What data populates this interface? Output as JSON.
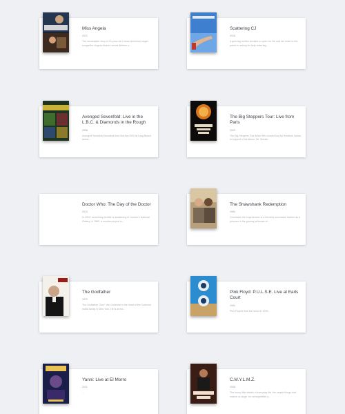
{
  "movies": [
    {
      "title": "Miss Angela",
      "year": "2021",
      "overview": "The remarkable story of 91-year-old Cuban-American singer-songwriter Angela Alvarez whose lifetime o..."
    },
    {
      "title": "Scattering CJ",
      "year": "2016",
      "overview": "A grieving mother decides to open her life and her heart to the public in asking for help restoring..."
    },
    {
      "title": "Avenged Sevenfold: Live in the L.B.C. & Diamonds in the Rough",
      "year": "2008",
      "overview": "Avenged Sevenfold recorded their first live DVD at Long Beach arena..."
    },
    {
      "title": "The Big Steppers Tour: Live from Paris",
      "year": "2022",
      "overview": "The Big Steppers Tour is the fifth concert tour by Kendrick Lamar, in support of his album, Mr. Morale..."
    },
    {
      "title": "Doctor Who: The Day of the Doctor",
      "year": "2013",
      "overview": "In 2013, something terrible is awakening in London's National Gallery; in 1562, a murderous plot is..."
    },
    {
      "title": "The Shawshank Redemption",
      "year": "1994",
      "overview": "Chronicles the experiences of a formerly successful banker as a prisoner in the gloomy jailhouse of..."
    },
    {
      "title": "The Godfather",
      "year": "1972",
      "overview": "The Godfather \"Don\" Vito Corleone is the head of the Corleone mafia family in New York. He is at the..."
    },
    {
      "title": "Pink Floyd: P.U.L.S.E. Live at Earls Court",
      "year": "1994",
      "overview": "Pink Floyd's final live show in 1995..."
    },
    {
      "title": "Yanni: Live at El Morro",
      "year": "2011",
      "overview": "..."
    },
    {
      "title": "C.M.Y.L.M.Z.",
      "year": "2008",
      "overview": "The funny little details of everyday life, the simple things that makes us laugh. An unforgettable p..."
    }
  ],
  "poster_icons": [
    "miss-angela-poster-icon",
    "scattering-cj-poster-icon",
    "avenged-sevenfold-poster-icon",
    "big-steppers-poster-icon",
    "doctor-who-poster-icon",
    "shawshank-poster-icon",
    "godfather-poster-icon",
    "pink-floyd-poster-icon",
    "yanni-poster-icon",
    "cmylmz-poster-icon"
  ],
  "colors": {
    "background": "#eef0f4",
    "card": "#ffffff",
    "title_text": "#3a3f47",
    "meta_text": "#9aa0a8"
  }
}
